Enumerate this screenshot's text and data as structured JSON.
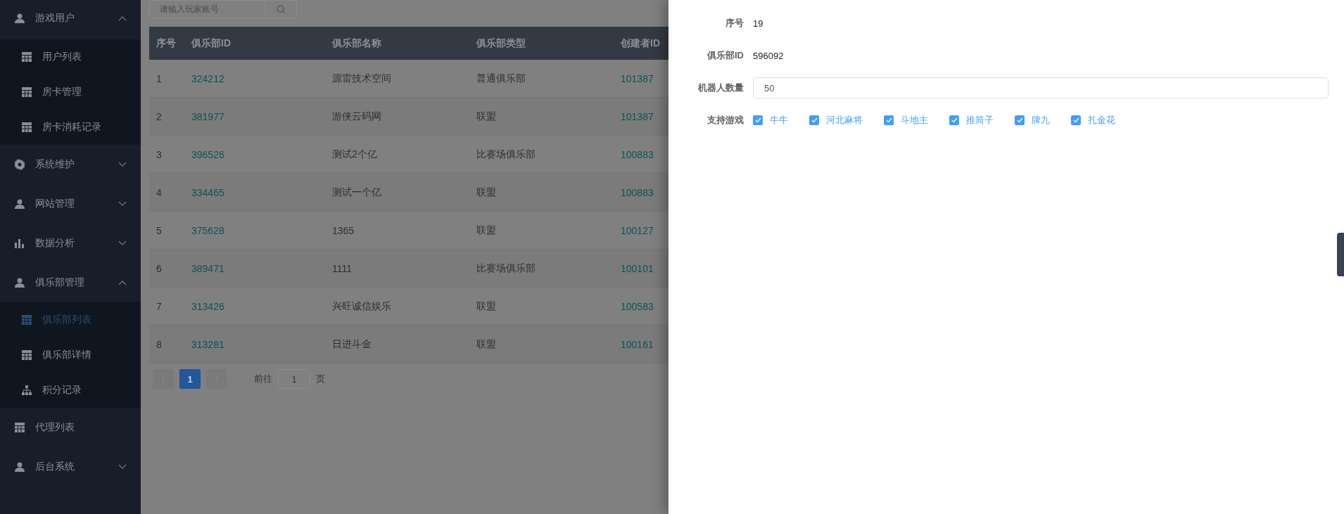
{
  "sidebar": {
    "items": [
      {
        "label": "游戏用户",
        "expanded": true,
        "children": [
          {
            "label": "用户列表",
            "selected": false
          },
          {
            "label": "房卡管理",
            "selected": false
          },
          {
            "label": "房卡消耗记录",
            "selected": false
          }
        ]
      },
      {
        "label": "系统维护",
        "expanded": false
      },
      {
        "label": "网站管理",
        "expanded": false
      },
      {
        "label": "数据分析",
        "expanded": false
      },
      {
        "label": "俱乐部管理",
        "expanded": true,
        "children": [
          {
            "label": "俱乐部列表",
            "selected": true
          },
          {
            "label": "俱乐部详情",
            "selected": false
          },
          {
            "label": "积分记录",
            "selected": false
          }
        ]
      },
      {
        "label": "代理列表"
      },
      {
        "label": "后台系统",
        "expanded": false
      }
    ]
  },
  "search": {
    "placeholder": "请输入玩家账号"
  },
  "table": {
    "columns": [
      "序号",
      "俱乐部ID",
      "俱乐部名称",
      "俱乐部类型",
      "创建者ID"
    ],
    "rows": [
      [
        "1",
        "324212",
        "源雷技术空间",
        "普通俱乐部",
        "101387"
      ],
      [
        "2",
        "381977",
        "游侠云码网",
        "联盟",
        "101387"
      ],
      [
        "3",
        "396526",
        "测试2个亿",
        "比赛场俱乐部",
        "100883"
      ],
      [
        "4",
        "334465",
        "测试一个亿",
        "联盟",
        "100883"
      ],
      [
        "5",
        "375628",
        "1365",
        "联盟",
        "100127"
      ],
      [
        "6",
        "389471",
        "1111",
        "比赛场俱乐部",
        "100101"
      ],
      [
        "7",
        "313426",
        "兴旺诚信娱乐",
        "联盟",
        "100583"
      ],
      [
        "8",
        "313281",
        "日进斗金",
        "联盟",
        "100161"
      ]
    ]
  },
  "pagination": {
    "pages": [
      {
        "label": "1",
        "selected": true
      }
    ],
    "goto_label": "前往",
    "goto_value": "1",
    "page_suffix": "页"
  },
  "drawer": {
    "fields": [
      {
        "kind": "text",
        "label": "序号",
        "value": "19"
      },
      {
        "kind": "text",
        "label": "俱乐部ID",
        "value": "596092"
      },
      {
        "kind": "input",
        "label": "机器人数量",
        "value": "50"
      },
      {
        "kind": "checkboxes",
        "label": "支持游戏",
        "options": [
          {
            "label": "牛牛",
            "checked": true
          },
          {
            "label": "河北麻将",
            "checked": true
          },
          {
            "label": "斗地主",
            "checked": true
          },
          {
            "label": "推筒子",
            "checked": true
          },
          {
            "label": "牌九",
            "checked": true
          },
          {
            "label": "扎金花",
            "checked": true
          }
        ]
      }
    ]
  }
}
